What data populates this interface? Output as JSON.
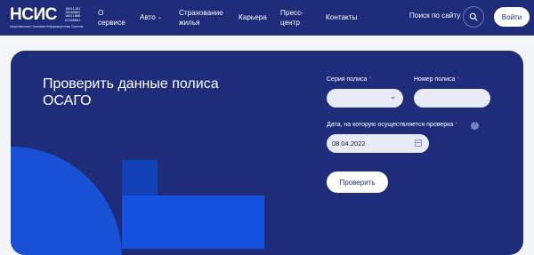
{
  "brand": {
    "logo_text": "НСИС",
    "logo_digits": "10011101\n10100001\n10011000\n01100001",
    "logo_subtitle": "Национальная Страховая Информационная Система"
  },
  "nav": {
    "items": [
      {
        "label": "О\nсервисе"
      },
      {
        "label": "Авто",
        "has_dropdown": true
      },
      {
        "label": "Страхование\nжилья"
      },
      {
        "label": "Карьера"
      },
      {
        "label": "Пресс-\nцентр"
      },
      {
        "label": "Контакты"
      }
    ],
    "search_label": "Поиск по сайту",
    "login_label": "Войти"
  },
  "form": {
    "title": "Проверить данные полиса ОСАГО",
    "series_label": "Серия полиса",
    "number_label": "Номер полиса",
    "required_mark": "*",
    "date_label": "Дата, на которую осуществляется проверка",
    "date_value": "08.04.2022",
    "submit_label": "Проверить"
  },
  "colors": {
    "primary": "#1e2c7a",
    "accent": "#1552e0",
    "required": "#e54a5a"
  }
}
